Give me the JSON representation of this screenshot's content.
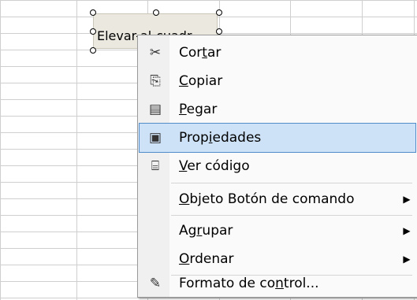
{
  "button": {
    "caption": "Elevar-al-cuadr"
  },
  "menu": {
    "items": [
      {
        "pre": "Cor",
        "u": "t",
        "post": "ar",
        "icon": "scissors-icon",
        "glyph": "✂"
      },
      {
        "pre": "",
        "u": "C",
        "post": "opiar",
        "icon": "copy-icon",
        "glyph": "⎘"
      },
      {
        "pre": "",
        "u": "P",
        "post": "egar",
        "icon": "paste-icon",
        "glyph": "📋"
      },
      {
        "pre": "Prop",
        "u": "i",
        "post": "edades",
        "icon": "properties-icon",
        "glyph": "🗔"
      },
      {
        "pre": "",
        "u": "V",
        "post": "er código",
        "icon": "view-code-icon",
        "glyph": "⌸"
      },
      {
        "pre": "",
        "u": "O",
        "post": "bjeto Botón de comando",
        "icon": "",
        "glyph": ""
      },
      {
        "pre": "Ag",
        "u": "r",
        "post": "upar",
        "icon": "",
        "glyph": ""
      },
      {
        "pre": "",
        "u": "O",
        "post": "rdenar",
        "icon": "",
        "glyph": ""
      },
      {
        "pre": "Formato de co",
        "u": "n",
        "post": "trol...",
        "icon": "format-control-icon",
        "glyph": "✎"
      }
    ],
    "submenu_arrow": "▶"
  }
}
